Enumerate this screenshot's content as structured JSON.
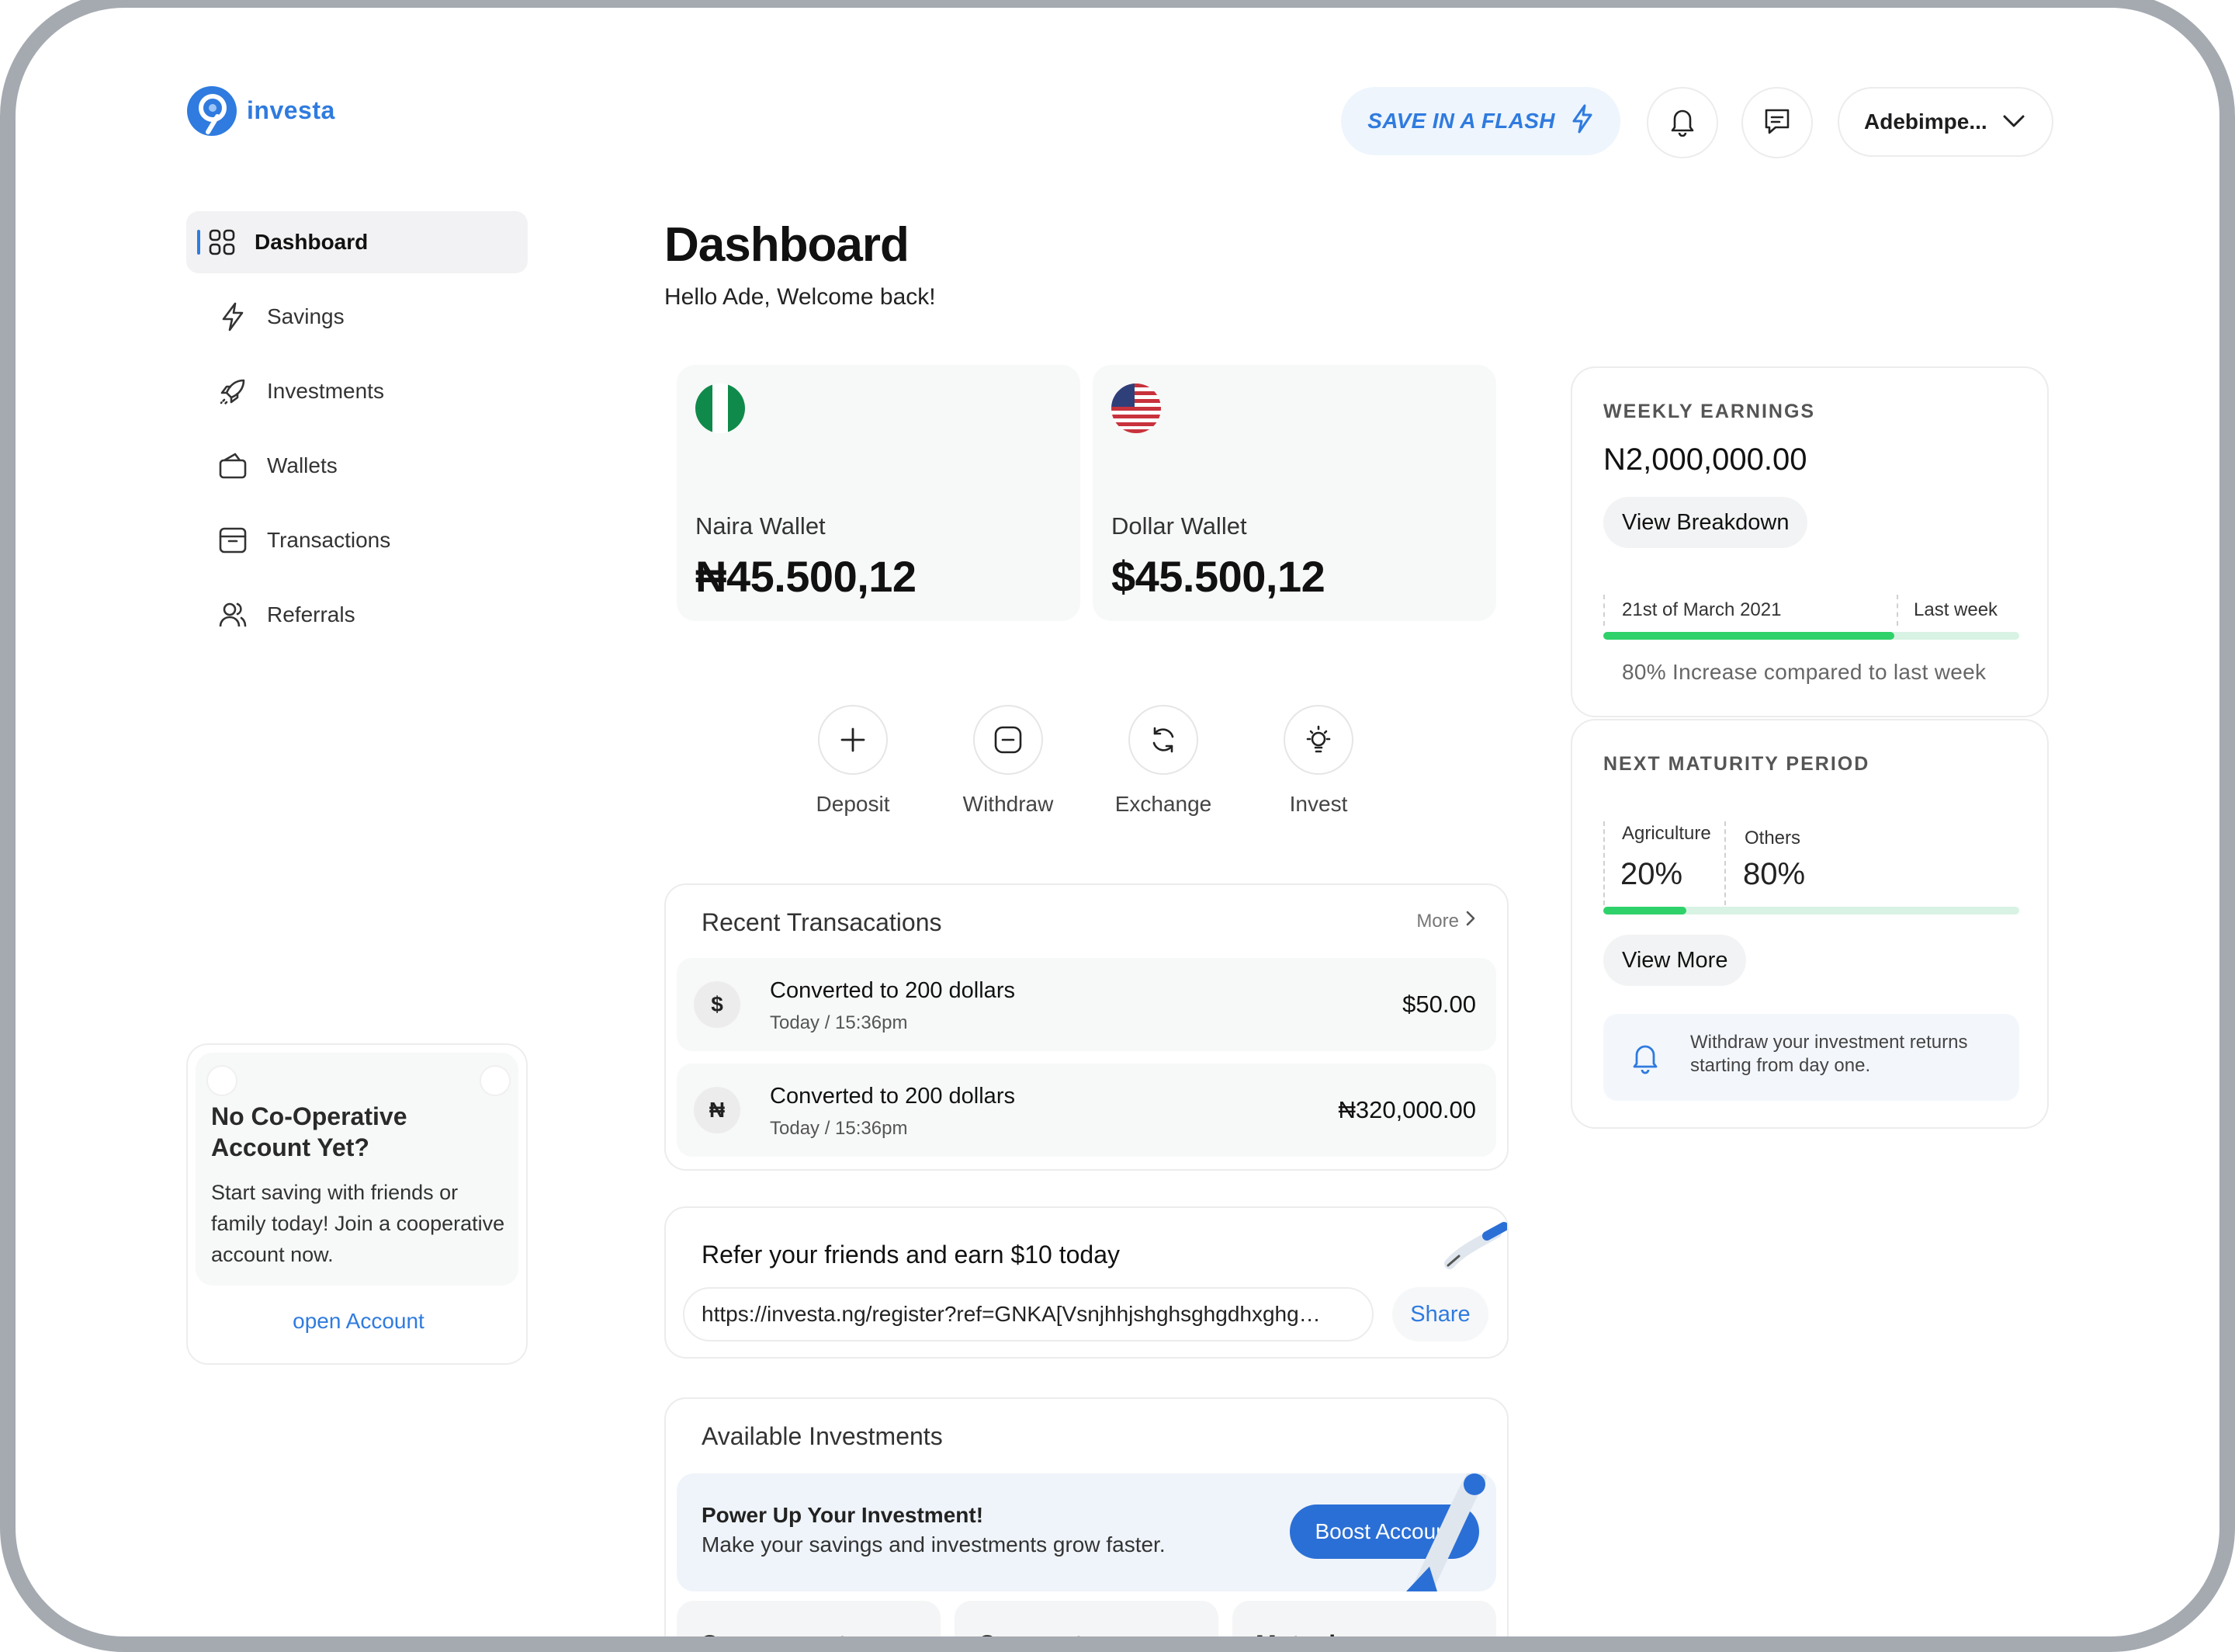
{
  "app": {
    "name": "investa"
  },
  "header": {
    "save_flash_label": "SAVE IN A FLASH",
    "user_name": "Adebimpe..."
  },
  "sidebar": {
    "items": [
      {
        "label": "Dashboard",
        "icon": "grid-icon",
        "active": true
      },
      {
        "label": "Savings",
        "icon": "lightning-icon",
        "active": false
      },
      {
        "label": "Investments",
        "icon": "rocket-icon",
        "active": false
      },
      {
        "label": "Wallets",
        "icon": "wallet-icon",
        "active": false
      },
      {
        "label": "Transactions",
        "icon": "archive-icon",
        "active": false
      },
      {
        "label": "Referrals",
        "icon": "users-icon",
        "active": false
      }
    ],
    "coop": {
      "title": "No Co-Operative Account Yet?",
      "text": "Start saving with friends or family today! Join a cooperative account now.",
      "link": "open Account"
    }
  },
  "main": {
    "title": "Dashboard",
    "subtitle": "Hello Ade, Welcome back!",
    "wallets": [
      {
        "name": "Naira Wallet",
        "amount": "₦45.500,12",
        "flag": "nigeria-flag-icon"
      },
      {
        "name": "Dollar Wallet",
        "amount": "$45.500,12",
        "flag": "usa-flag-icon"
      }
    ],
    "actions": [
      {
        "label": "Deposit",
        "icon": "plus-icon"
      },
      {
        "label": "Withdraw",
        "icon": "minus-square-icon"
      },
      {
        "label": "Exchange",
        "icon": "refresh-icon"
      },
      {
        "label": "Invest",
        "icon": "lightbulb-icon"
      }
    ],
    "recent": {
      "title": "Recent Transacations",
      "more": "More",
      "rows": [
        {
          "currency_symbol": "$",
          "name": "Converted to 200 dollars",
          "time": "Today / 15:36pm",
          "amount": "$50.00"
        },
        {
          "currency_symbol": "₦",
          "name": "Converted to 200 dollars",
          "time": "Today / 15:36pm",
          "amount": "₦320,000.00"
        }
      ]
    },
    "refer": {
      "title": "Refer your friends and earn $10 today",
      "link": "https://investa.ng/register?ref=GNKA[Vsnjhhjshghsghgdhxghg…",
      "share": "Share"
    },
    "investments": {
      "title": "Available Investments",
      "boost_title": "Power Up Your Investment!",
      "boost_text": "Make your savings and investments grow faster.",
      "boost_button": "Boost Account",
      "tabs": [
        "Government",
        "Corporate",
        "Mutual"
      ]
    }
  },
  "right": {
    "weekly": {
      "heading": "WEEKLY EARNINGS",
      "amount": "N2,000,000.00",
      "button": "View Breakdown",
      "date_label": "21st of March 2021",
      "last_label": "Last week",
      "progress": 0.7,
      "note": "80% Increase compared to last week"
    },
    "maturity": {
      "heading": "NEXT MATURITY PERIOD",
      "segments": [
        {
          "label": "Agriculture",
          "value": "20%"
        },
        {
          "label": "Others",
          "value": "80%"
        }
      ],
      "agriculture_fraction": 0.2,
      "button": "View More",
      "notice": "Withdraw your investment returns starting from day one."
    }
  },
  "colors": {
    "accent": "#2f7bdf",
    "progress": "#2fd16a",
    "track": "#d8f3e3",
    "boost": "#2a6fd6"
  }
}
